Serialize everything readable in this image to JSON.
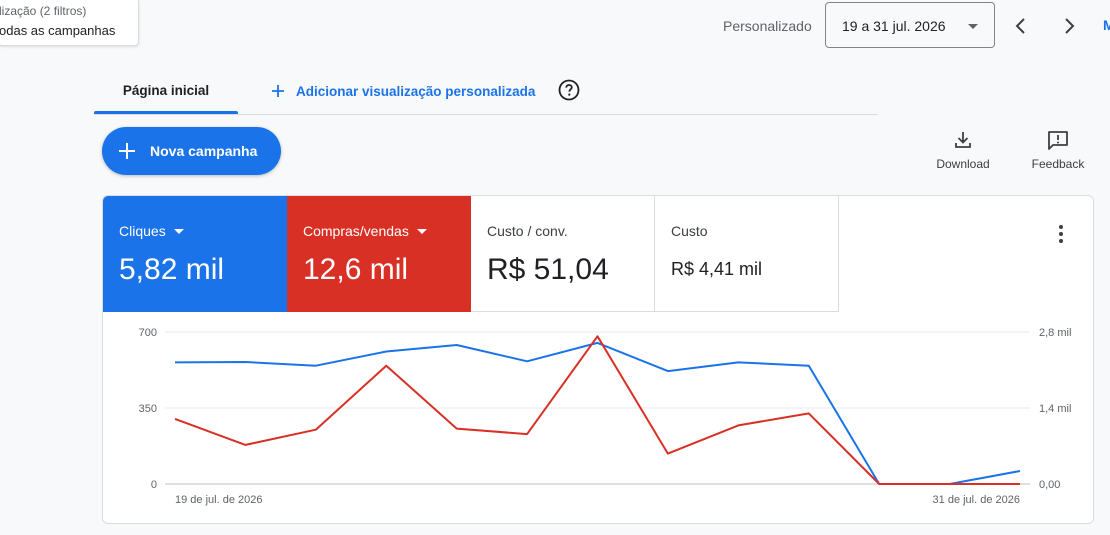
{
  "tooltip": {
    "line1": "lização (2 filtros)",
    "line2": "odas as campanhas"
  },
  "date_range": {
    "label": "Personalizado",
    "value": "19 a 31 jul. 2026",
    "more": "M"
  },
  "tabs": [
    {
      "label": "Página inicial",
      "active": true
    },
    {
      "label": "Adicionar visualização personalizada",
      "active": false
    }
  ],
  "actions": {
    "new_campaign": "Nova campanha",
    "download": "Download",
    "feedback": "Feedback"
  },
  "metrics": [
    {
      "label": "Cliques",
      "value": "5,82 mil",
      "color": "#1a73e8"
    },
    {
      "label": "Compras/vendas",
      "value": "12,6 mil",
      "color": "#d93025"
    },
    {
      "label": "Custo / conv.",
      "value": "R$ 51,04"
    },
    {
      "label": "Custo",
      "value": "R$ 4,41 mil"
    }
  ],
  "chart_data": {
    "type": "line",
    "x": [
      "19 jul",
      "20 jul",
      "21 jul",
      "22 jul",
      "23 jul",
      "24 jul",
      "25 jul",
      "26 jul",
      "27 jul",
      "28 jul",
      "29 jul",
      "30 jul",
      "31 jul"
    ],
    "x_tick_labels": [
      "19 de jul. de 2026",
      "31 de jul. de 2026"
    ],
    "left_axis": {
      "ticks": [
        0,
        350,
        700
      ],
      "tick_labels": [
        "0",
        "350",
        "700"
      ],
      "ylim": [
        0,
        700
      ]
    },
    "right_axis": {
      "ticks": [
        0,
        1400,
        2800
      ],
      "tick_labels": [
        "0,00",
        "1,4 mil",
        "2,8 mil"
      ],
      "ylim": [
        0,
        2800
      ]
    },
    "grid": true,
    "series": [
      {
        "name": "Cliques",
        "axis": "left",
        "color": "#1a73e8",
        "values": [
          560,
          562,
          545,
          610,
          640,
          565,
          650,
          520,
          560,
          545,
          0,
          0,
          60
        ]
      },
      {
        "name": "Compras/vendas",
        "axis": "right",
        "color": "#d93025",
        "values": [
          1200,
          720,
          1000,
          2180,
          1020,
          920,
          2720,
          560,
          1080,
          1300,
          0,
          0,
          0
        ]
      }
    ]
  }
}
